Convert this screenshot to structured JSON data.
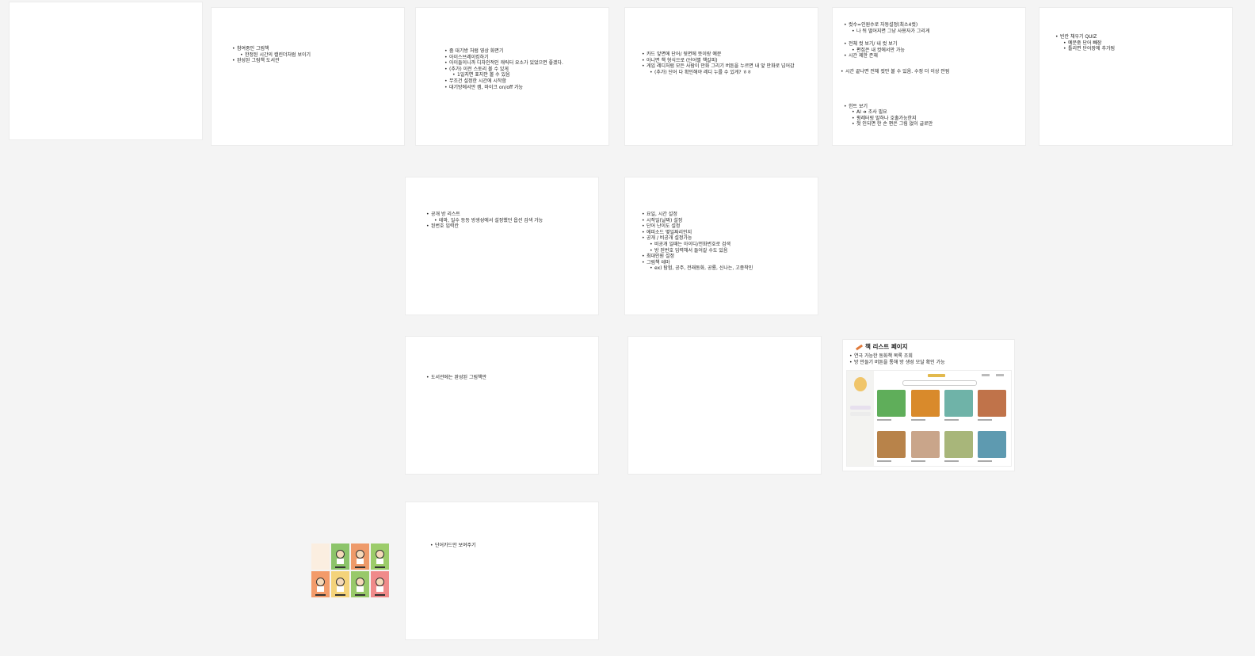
{
  "frames": {
    "f2": [
      "참여중인 그림책",
      "한정된 시간의 캘린더처럼 보이기",
      "완성된 그림책 도서관"
    ],
    "f3": [
      "줌 대기방 처럼 영상 화면기",
      "아이스브레이킹하기",
      "아이들이니까 디자인적인 캐릭터 요소가 있었으면 좋겠다.",
      "(추가) 이전 스토리 볼 수 있게",
      "1일지면 표지만 볼 수 있음",
      "무조건 설정한 시간에 시작함",
      "대기방에서만 캠, 마이크 on/off 가능"
    ],
    "f4": [
      "카드 앞면에 단어/ 뒷면에 뜻이랑 예문",
      "아니면 책 형식으로 (단어별 책갈피)",
      "게임 레디처럼 모든 사람이 만화 그리기 버튼을 누르면 내 앞 만화로 넘어감",
      "(추가) 단어 다 확인해야 레디 누를 수 있게? ㅎㅎ"
    ],
    "f5": [
      "컷수=인원수로 자동설정(최소4컷)",
      "나 뒤 떨어지면 그냥 사용자가 그리게",
      "전체 컷 보기/ 내 컷 보기",
      "편집은 내 컷에서만 가능",
      "시간 제한 존재",
      "시간 끝나면 전체 컷만 볼 수 있음. 수정 더 이상 안됨",
      "힌트 보기",
      "AI ➜ 조사 필요",
      "횡레터링 말하나 호출가능한지",
      "첫 인되면 한 손 편은 그림 없이 글로만"
    ],
    "f6": [
      "빈칸 채우기 QUIZ",
      "예문중 단어 빼장",
      "틀리면 단어장에 추가됨"
    ],
    "f7": [
      "공개 방 리스트",
      "테마, 일수 등등 방생성에서 설정했던 옵션 검색 가능",
      "된번호 입력칸"
    ],
    "f8": [
      "요일, 시간 설정",
      "시작일(날짜) 설정",
      "단어 난이도 설정",
      "에피소드 몇일짜리인지",
      "공개 / 비공개 설정가능",
      "비공개 일때는 아이디/전화번호로 검색",
      "방 된번호 입력해서 들어갈 수도 있음",
      "최대인원 설정",
      "그림책 테마",
      "ex) 탐험, 공주, 전래동화, 공룡, 신나는, 고종착인"
    ],
    "f9": [
      "도서관에는 완성된 그림책만"
    ],
    "f12": [
      "단어카드만 보여주기"
    ]
  },
  "book_page": {
    "title": "책 리스트 페이지",
    "notes": [
      "연극 가능한 동화책 목록 조회",
      "방 만들기 버튼을 통해 방 생성 모달 확인 가능"
    ]
  },
  "colors": {
    "canvas": "#f4f4f4",
    "frame": "#ffffff"
  },
  "icons": [
    "pencil-icon"
  ]
}
